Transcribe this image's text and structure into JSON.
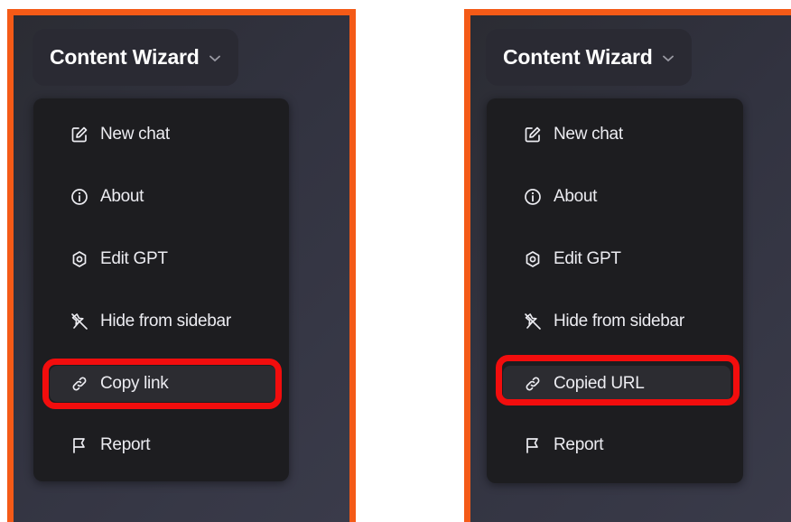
{
  "colors": {
    "border_accent": "#f45a17",
    "highlight_ring": "#f20d0d",
    "panel_bg": "#2f303b",
    "menu_bg": "#1d1d20",
    "text": "#ececf1"
  },
  "left_panel": {
    "gpt_title": "Content Wizard",
    "menu": [
      {
        "label": "New chat",
        "icon": "edit-icon"
      },
      {
        "label": "About",
        "icon": "info-icon"
      },
      {
        "label": "Edit GPT",
        "icon": "settings-icon"
      },
      {
        "label": "Hide from sidebar",
        "icon": "unpin-icon"
      },
      {
        "label": "Copy link",
        "icon": "link-icon",
        "highlighted": true
      },
      {
        "label": "Report",
        "icon": "flag-icon"
      }
    ]
  },
  "right_panel": {
    "gpt_title": "Content Wizard",
    "menu": [
      {
        "label": "New chat",
        "icon": "edit-icon"
      },
      {
        "label": "About",
        "icon": "info-icon"
      },
      {
        "label": "Edit GPT",
        "icon": "settings-icon"
      },
      {
        "label": "Hide from sidebar",
        "icon": "unpin-icon"
      },
      {
        "label": "Copied URL",
        "icon": "link-icon",
        "highlighted": true
      },
      {
        "label": "Report",
        "icon": "flag-icon"
      }
    ]
  }
}
